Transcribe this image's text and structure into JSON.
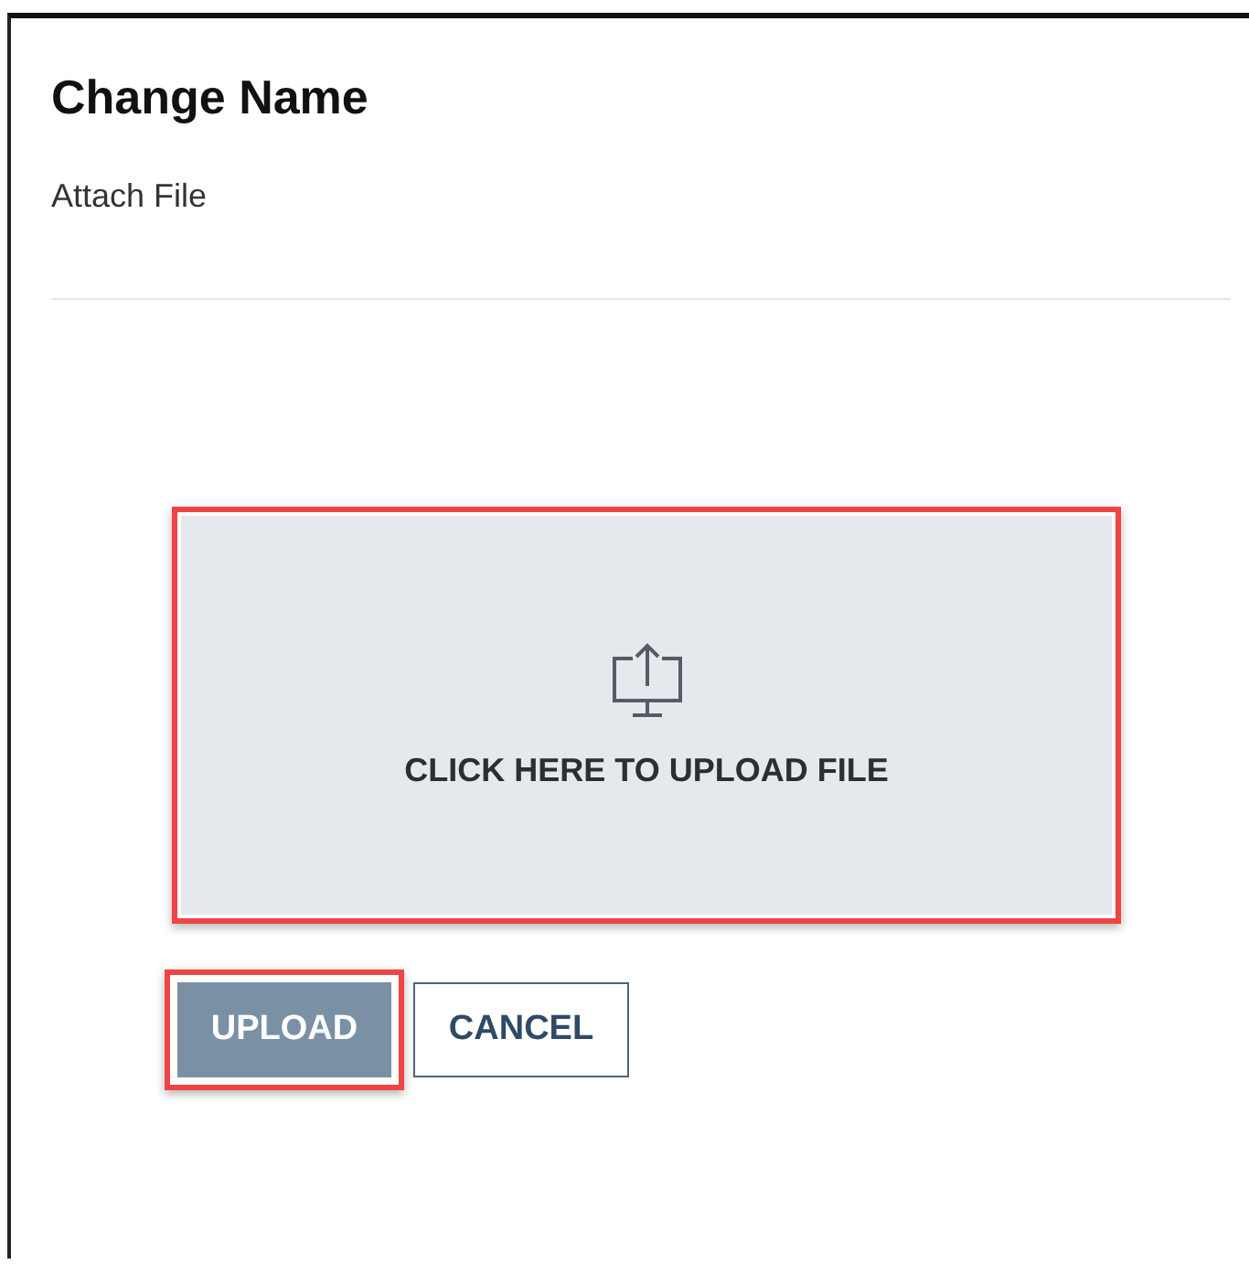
{
  "dialog": {
    "title": "Change Name",
    "subtitle": "Attach File"
  },
  "dropzone": {
    "label": "CLICK HERE TO UPLOAD FILE",
    "highlighted": true
  },
  "buttons": [
    {
      "label": "UPLOAD",
      "kind": "primary",
      "highlighted": true
    },
    {
      "label": "CANCEL",
      "kind": "secondary",
      "highlighted": false
    }
  ]
}
